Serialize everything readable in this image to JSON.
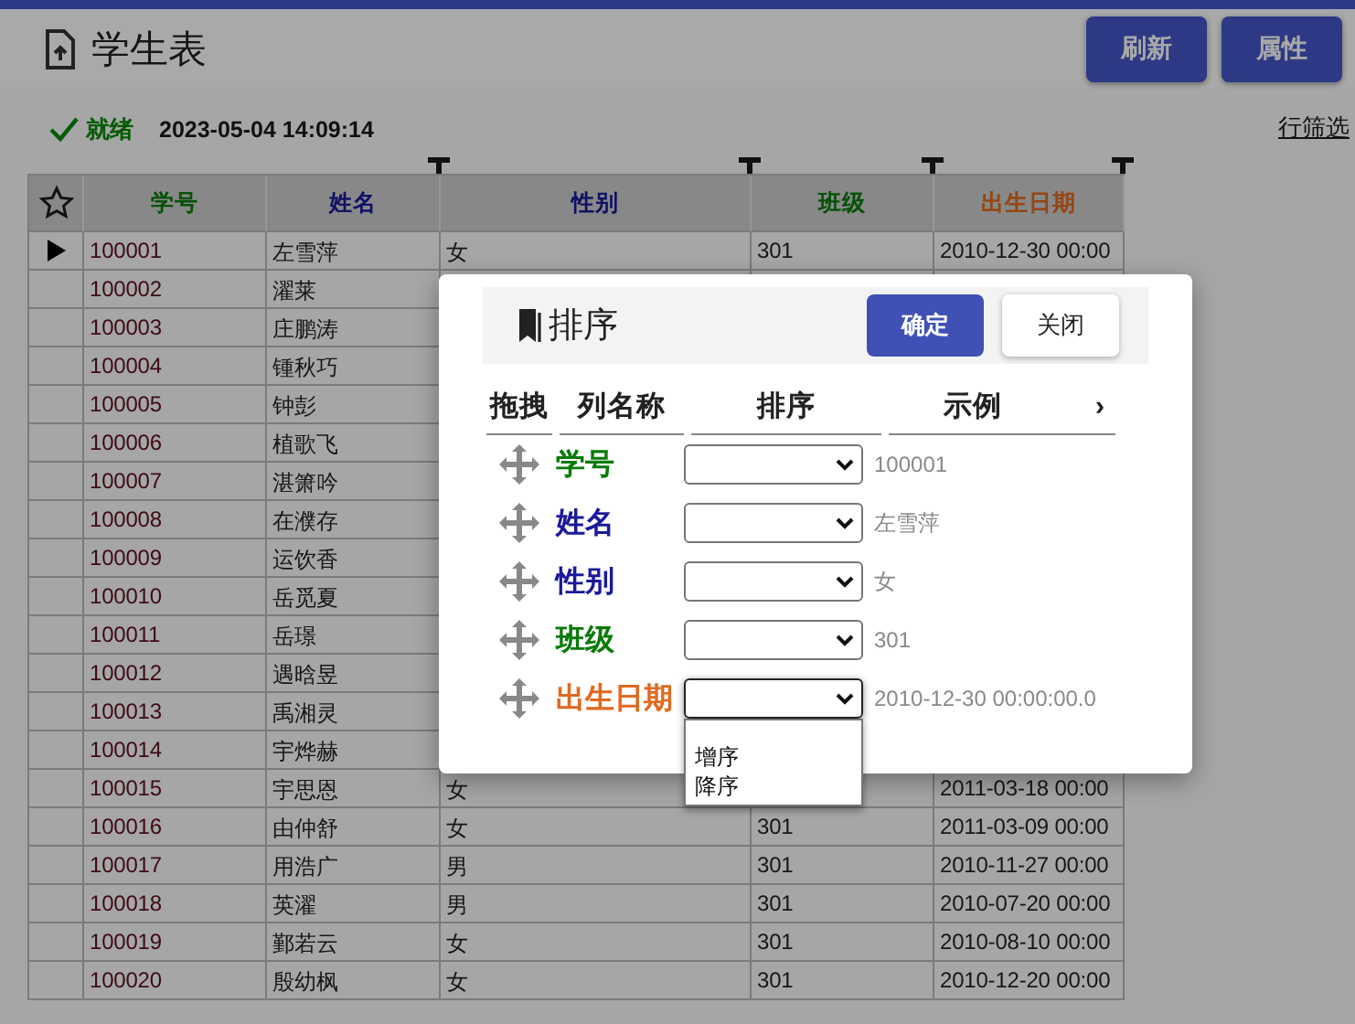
{
  "header": {
    "title": "学生表",
    "buttons": [
      "刷新",
      "属性"
    ]
  },
  "status": {
    "state": "就绪",
    "time": "2023-05-04 14:09:14",
    "filter_link": "行筛选"
  },
  "table": {
    "columns": [
      {
        "label": "学号",
        "color": "#075107"
      },
      {
        "label": "姓名",
        "color": "#111166"
      },
      {
        "label": "性别",
        "color": "#111166"
      },
      {
        "label": "班级",
        "color": "#075107"
      },
      {
        "label": "出生日期",
        "color": "#944615"
      }
    ],
    "rows": [
      {
        "selected": true,
        "cells": [
          "100001",
          "左雪萍",
          "女",
          "301",
          "2010-12-30 00:00"
        ]
      },
      {
        "selected": false,
        "cells": [
          "100002",
          "濯莱"
        ]
      },
      {
        "selected": false,
        "cells": [
          "100003",
          "庄鹏涛"
        ]
      },
      {
        "selected": false,
        "cells": [
          "100004",
          "锺秋巧"
        ]
      },
      {
        "selected": false,
        "cells": [
          "100005",
          "钟彭"
        ]
      },
      {
        "selected": false,
        "cells": [
          "100006",
          "植歌飞"
        ]
      },
      {
        "selected": false,
        "cells": [
          "100007",
          "湛箫吟"
        ]
      },
      {
        "selected": false,
        "cells": [
          "100008",
          "在濮存"
        ]
      },
      {
        "selected": false,
        "cells": [
          "100009",
          "运饮香"
        ]
      },
      {
        "selected": false,
        "cells": [
          "100010",
          "岳觅夏"
        ]
      },
      {
        "selected": false,
        "cells": [
          "100011",
          "岳璟"
        ]
      },
      {
        "selected": false,
        "cells": [
          "100012",
          "遇晗昱"
        ]
      },
      {
        "selected": false,
        "cells": [
          "100013",
          "禹湘灵"
        ]
      },
      {
        "selected": false,
        "cells": [
          "100014",
          "宇烨赫"
        ]
      },
      {
        "selected": false,
        "cells": [
          "100015",
          "宇思恩",
          "女",
          null,
          "2011-03-18 00:00"
        ]
      },
      {
        "selected": false,
        "cells": [
          "100016",
          "由仲舒",
          "女",
          "301",
          "2011-03-09 00:00"
        ]
      },
      {
        "selected": false,
        "cells": [
          "100017",
          "用浩广",
          "男",
          "301",
          "2010-11-27 00:00"
        ]
      },
      {
        "selected": false,
        "cells": [
          "100018",
          "英濯",
          "男",
          "301",
          "2010-07-20 00:00"
        ]
      },
      {
        "selected": false,
        "cells": [
          "100019",
          "鄞若云",
          "女",
          "301",
          "2010-08-10 00:00"
        ]
      },
      {
        "selected": false,
        "cells": [
          "100020",
          "殷幼枫",
          "女",
          "301",
          "2010-12-20 00:00"
        ]
      }
    ]
  },
  "sort_dialog": {
    "title": "排序",
    "ok_button": "确定",
    "close_button": "关闭",
    "columns": [
      "拖拽",
      "列名称",
      "排序",
      "示例"
    ],
    "more": "›",
    "rows": [
      {
        "name": "学号",
        "color": "#0a7a0a",
        "example": "100001",
        "dropdown_open": false
      },
      {
        "name": "姓名",
        "color": "#1a1a9a",
        "example": "左雪萍",
        "dropdown_open": false
      },
      {
        "name": "性别",
        "color": "#1a1a9a",
        "example": "女",
        "dropdown_open": false
      },
      {
        "name": "班级",
        "color": "#0a7a0a",
        "example": "301",
        "dropdown_open": false
      },
      {
        "name": "出生日期",
        "color": "#e06a20",
        "example": "2010-12-30 00:00:00.0",
        "dropdown_open": true
      }
    ],
    "dropdown_options": [
      "增序",
      "降序"
    ]
  }
}
